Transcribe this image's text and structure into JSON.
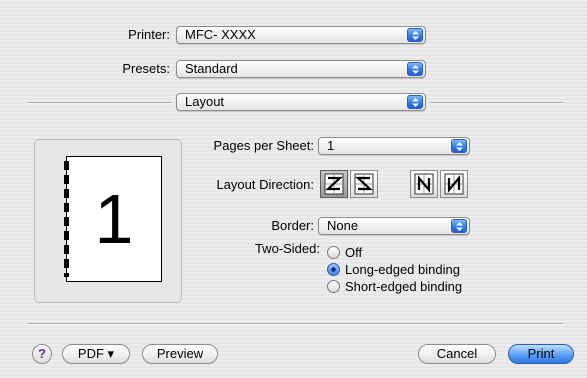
{
  "printer": {
    "label": "Printer:",
    "value": "MFC- XXXX"
  },
  "presets": {
    "label": "Presets:",
    "value": "Standard"
  },
  "panel": {
    "value": "Layout"
  },
  "preview": {
    "page_number": "1"
  },
  "layout": {
    "pages_per_sheet_label": "Pages per Sheet:",
    "pages_per_sheet_value": "1",
    "direction_label": "Layout Direction:",
    "directions": [
      "z-order",
      "reverse-s-order",
      "reverse-n-order",
      "n-order"
    ],
    "selected_direction": "z-order",
    "border_label": "Border:",
    "border_value": "None",
    "two_sided_label": "Two-Sided:",
    "two_sided_options": [
      "Off",
      "Long-edged binding",
      "Short-edged binding"
    ],
    "two_sided_selected": "Long-edged binding"
  },
  "footer": {
    "help_label": "?",
    "pdf_label": "PDF ▾",
    "preview_label": "Preview",
    "cancel_label": "Cancel",
    "print_label": "Print"
  },
  "colors": {
    "accent": "#3a7ff0"
  }
}
